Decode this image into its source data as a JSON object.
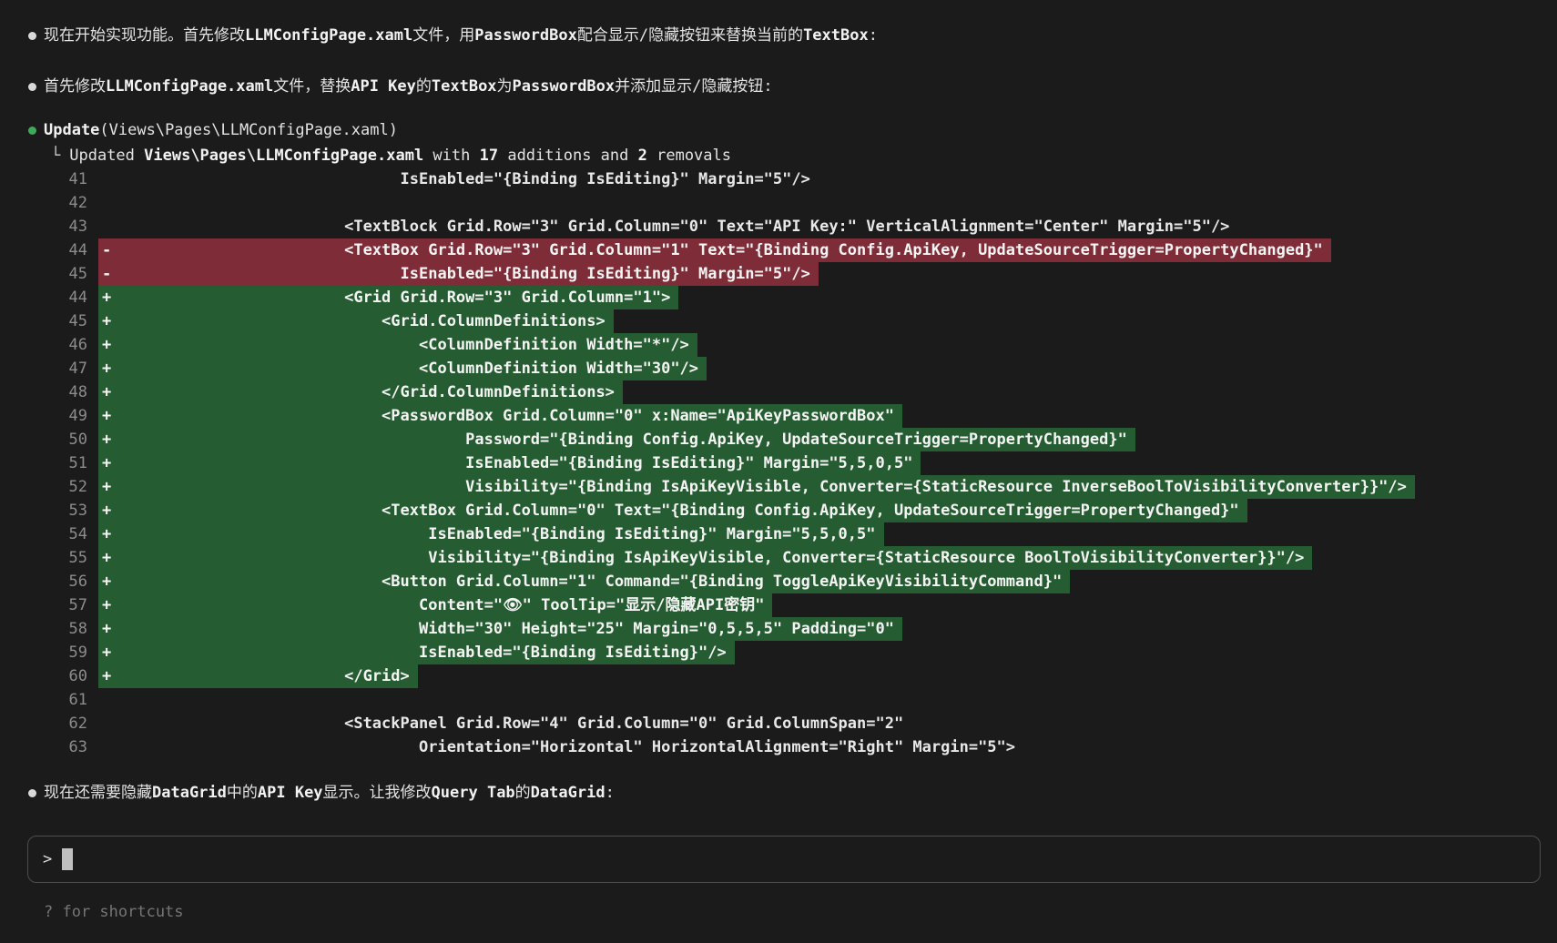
{
  "colors": {
    "background": "#1b1b1b",
    "text": "#e3e3e3",
    "dim_text": "#757575",
    "line_number": "#8c8c8c",
    "diff_add_bg": "#265c31",
    "diff_del_bg": "#7e2d38",
    "tool_bullet_green": "#3fa95b",
    "message_bullet": "#d9d9d9"
  },
  "messages_top": [
    {
      "segments": [
        {
          "text": "现在开始实现功能。首先修改"
        },
        {
          "text": "LLMConfigPage.xaml",
          "code": true
        },
        {
          "text": "文件，用"
        },
        {
          "text": "PasswordBox",
          "code": true
        },
        {
          "text": "配合显示/隐藏按钮来替换当前的"
        },
        {
          "text": "TextBox",
          "code": true
        },
        {
          "text": ":"
        }
      ]
    },
    {
      "segments": [
        {
          "text": "首先修改"
        },
        {
          "text": "LLMConfigPage.xaml",
          "code": true
        },
        {
          "text": "文件，替换"
        },
        {
          "text": "API Key",
          "code": true
        },
        {
          "text": "的"
        },
        {
          "text": "TextBox",
          "code": true
        },
        {
          "text": "为"
        },
        {
          "text": "PasswordBox",
          "code": true
        },
        {
          "text": "并添加显示/隐藏按钮:"
        }
      ]
    }
  ],
  "tool": {
    "title_segments": [
      {
        "text": "Update",
        "code": true
      },
      {
        "text": "(Views\\Pages\\LLMConfigPage.xaml)"
      }
    ],
    "elbow": "└",
    "result_segments": [
      {
        "text": "Updated "
      },
      {
        "text": "Views\\Pages\\LLMConfigPage.xaml",
        "code": true
      },
      {
        "text": " with "
      },
      {
        "text": "17",
        "code": true
      },
      {
        "text": " additions and "
      },
      {
        "text": "2",
        "code": true
      },
      {
        "text": " removals"
      }
    ]
  },
  "diff": {
    "lines": [
      {
        "num": "41",
        "type": "ctx",
        "code": "                              IsEnabled=\"{Binding IsEditing}\" Margin=\"5\"/>"
      },
      {
        "num": "42",
        "type": "blank",
        "code": ""
      },
      {
        "num": "43",
        "type": "ctx",
        "code": "                        <TextBlock Grid.Row=\"3\" Grid.Column=\"0\" Text=\"API Key:\" VerticalAlignment=\"Center\" Margin=\"5\"/>"
      },
      {
        "num": "44",
        "type": "del",
        "code": "                        <TextBox Grid.Row=\"3\" Grid.Column=\"1\" Text=\"{Binding Config.ApiKey, UpdateSourceTrigger=PropertyChanged}\""
      },
      {
        "num": "45",
        "type": "del",
        "code": "                              IsEnabled=\"{Binding IsEditing}\" Margin=\"5\"/>"
      },
      {
        "num": "44",
        "type": "add",
        "code": "                        <Grid Grid.Row=\"3\" Grid.Column=\"1\">"
      },
      {
        "num": "45",
        "type": "add",
        "code": "                            <Grid.ColumnDefinitions>"
      },
      {
        "num": "46",
        "type": "add",
        "code": "                                <ColumnDefinition Width=\"*\"/>"
      },
      {
        "num": "47",
        "type": "add",
        "code": "                                <ColumnDefinition Width=\"30\"/>"
      },
      {
        "num": "48",
        "type": "add",
        "code": "                            </Grid.ColumnDefinitions>"
      },
      {
        "num": "49",
        "type": "add",
        "code": "                            <PasswordBox Grid.Column=\"0\" x:Name=\"ApiKeyPasswordBox\""
      },
      {
        "num": "50",
        "type": "add",
        "code": "                                     Password=\"{Binding Config.ApiKey, UpdateSourceTrigger=PropertyChanged}\""
      },
      {
        "num": "51",
        "type": "add",
        "code": "                                     IsEnabled=\"{Binding IsEditing}\" Margin=\"5,5,0,5\""
      },
      {
        "num": "52",
        "type": "add",
        "code": "                                     Visibility=\"{Binding IsApiKeyVisible, Converter={StaticResource InverseBoolToVisibilityConverter}}\"/>"
      },
      {
        "num": "53",
        "type": "add",
        "code": "                            <TextBox Grid.Column=\"0\" Text=\"{Binding Config.ApiKey, UpdateSourceTrigger=PropertyChanged}\""
      },
      {
        "num": "54",
        "type": "add",
        "code": "                                 IsEnabled=\"{Binding IsEditing}\" Margin=\"5,5,0,5\""
      },
      {
        "num": "55",
        "type": "add",
        "code": "                                 Visibility=\"{Binding IsApiKeyVisible, Converter={StaticResource BoolToVisibilityConverter}}\"/>"
      },
      {
        "num": "56",
        "type": "add",
        "code": "                            <Button Grid.Column=\"1\" Command=\"{Binding ToggleApiKeyVisibilityCommand}\""
      },
      {
        "num": "57",
        "type": "add",
        "code": "                                Content=\"👁\" ToolTip=\"显示/隐藏API密钥\""
      },
      {
        "num": "58",
        "type": "add",
        "code": "                                Width=\"30\" Height=\"25\" Margin=\"0,5,5,5\" Padding=\"0\""
      },
      {
        "num": "59",
        "type": "add",
        "code": "                                IsEnabled=\"{Binding IsEditing}\"/>"
      },
      {
        "num": "60",
        "type": "add",
        "code": "                        </Grid>"
      },
      {
        "num": "61",
        "type": "blank",
        "code": ""
      },
      {
        "num": "62",
        "type": "ctx",
        "code": "                        <StackPanel Grid.Row=\"4\" Grid.Column=\"0\" Grid.ColumnSpan=\"2\""
      },
      {
        "num": "63",
        "type": "ctx",
        "code": "                                Orientation=\"Horizontal\" HorizontalAlignment=\"Right\" Margin=\"5\">"
      }
    ]
  },
  "messages_bottom": [
    {
      "segments": [
        {
          "text": "现在还需要隐藏"
        },
        {
          "text": "DataGrid",
          "code": true
        },
        {
          "text": "中的"
        },
        {
          "text": "API Key",
          "code": true
        },
        {
          "text": "显示。让我修改"
        },
        {
          "text": "Query Tab",
          "code": true
        },
        {
          "text": "的"
        },
        {
          "text": "DataGrid",
          "code": true
        },
        {
          "text": ":"
        }
      ]
    }
  ],
  "input": {
    "prompt": ">",
    "hint": "? for shortcuts"
  }
}
